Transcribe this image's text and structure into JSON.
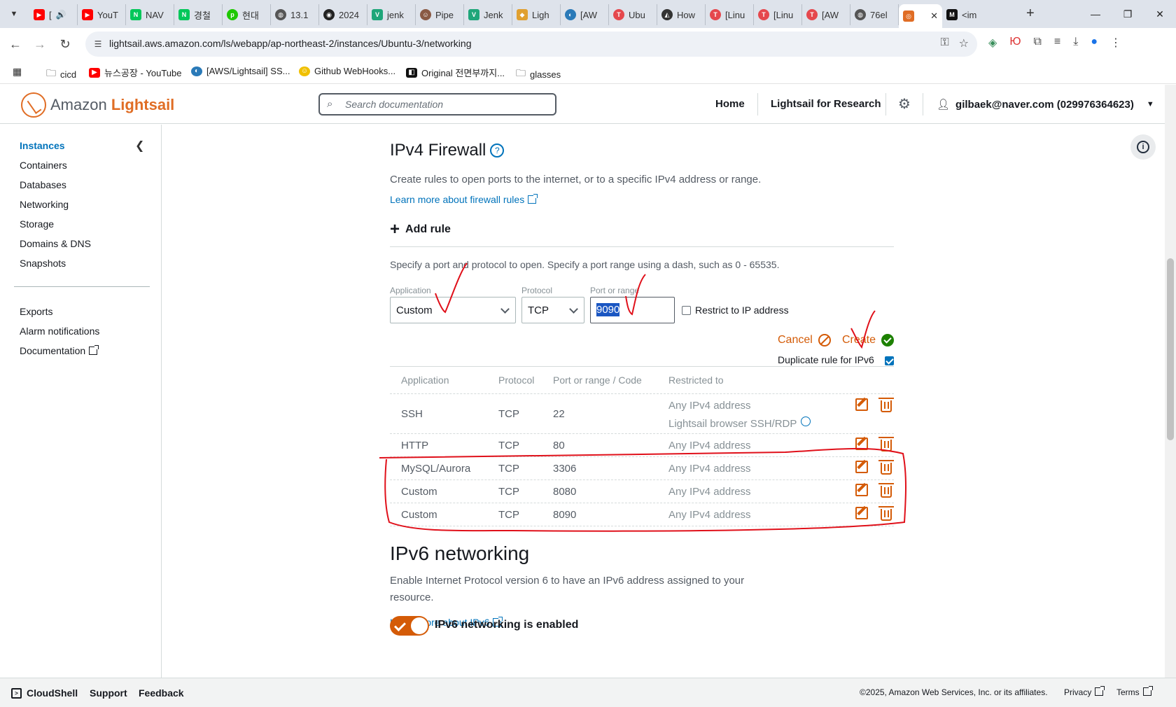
{
  "browser": {
    "tabs": [
      {
        "label": "[",
        "color": "#ff0000",
        "glyph": "▶"
      },
      {
        "label": "YouT",
        "color": "#ff0000",
        "glyph": "▶"
      },
      {
        "label": "NAV",
        "color": "#03c75a",
        "glyph": "N"
      },
      {
        "label": "경철",
        "color": "#03c75a",
        "glyph": "N"
      },
      {
        "label": "현대",
        "color": "#1ec800",
        "glyph": "p"
      },
      {
        "label": "13.1",
        "color": "#555555",
        "glyph": "◍"
      },
      {
        "label": "2024",
        "color": "#222222",
        "glyph": "◉"
      },
      {
        "label": "jenk",
        "color": "#1fa67a",
        "glyph": "V"
      },
      {
        "label": "Pipe",
        "color": "#8a5a44",
        "glyph": "☺"
      },
      {
        "label": "Jenk",
        "color": "#1fa67a",
        "glyph": "V"
      },
      {
        "label": "Ligh",
        "color": "#e0a030",
        "glyph": "◆"
      },
      {
        "label": "[AW",
        "color": "#2a7ab8",
        "glyph": "◐"
      },
      {
        "label": "Ubu",
        "color": "#e5484d",
        "glyph": "T"
      },
      {
        "label": "How",
        "color": "#333333",
        "glyph": "◭"
      },
      {
        "label": "[Linu",
        "color": "#e5484d",
        "glyph": "T"
      },
      {
        "label": "[Linu",
        "color": "#e5484d",
        "glyph": "T"
      },
      {
        "label": "[AW",
        "color": "#e5484d",
        "glyph": "T"
      },
      {
        "label": "76el",
        "color": "#555555",
        "glyph": "◍"
      }
    ],
    "active_tab": {
      "color": "#e06d25",
      "glyph": "◎"
    },
    "last_tab": {
      "label": "<im",
      "color": "#111111",
      "glyph": "M"
    },
    "url": "lightsail.aws.amazon.com/ls/webapp/ap-northeast-2/instances/Ubuntu-3/networking",
    "bookmarks": [
      {
        "label": "cicd",
        "icon": "folder-icon"
      },
      {
        "label": "뉴스공장 - YouTube",
        "icon": "youtube-icon"
      },
      {
        "label": "[AWS/Lightsail] SS...",
        "icon": "web-icon"
      },
      {
        "label": "Github WebHooks...",
        "icon": "web-icon"
      },
      {
        "label": "Original 전면부까지...",
        "icon": "web-icon"
      },
      {
        "label": "glasses",
        "icon": "folder-icon"
      }
    ]
  },
  "header": {
    "logo_prefix": "Amazon",
    "logo_brand": "Lightsail",
    "search_placeholder": "Search documentation",
    "home": "Home",
    "research": "Lightsail for Research",
    "account": "gilbaek@naver.com (029976364623)"
  },
  "sidebar": {
    "items": [
      "Instances",
      "Containers",
      "Databases",
      "Networking",
      "Storage",
      "Domains & DNS",
      "Snapshots"
    ],
    "items2": [
      "Exports",
      "Alarm notifications",
      "Documentation"
    ]
  },
  "firewall": {
    "title": "IPv4 Firewall",
    "description": "Create rules to open ports to the internet, or to a specific IPv4 address or range.",
    "learn_more": "Learn more about firewall rules",
    "add_rule": "Add rule",
    "add_rule_hint": "Specify a port and protocol to open. Specify a port range using a dash, such as 0 - 65535.",
    "form": {
      "application_label": "Application",
      "application_value": "Custom",
      "protocol_label": "Protocol",
      "protocol_value": "TCP",
      "port_label": "Port or range",
      "port_value": "9090",
      "restrict_label": "Restrict to IP address",
      "cancel": "Cancel",
      "create": "Create",
      "duplicate_label": "Duplicate rule for IPv6",
      "duplicate_checked": true
    },
    "columns": [
      "Application",
      "Protocol",
      "Port or range / Code",
      "Restricted to"
    ],
    "rows": [
      {
        "application": "SSH",
        "protocol": "TCP",
        "port": "22",
        "restricted": "Any IPv4 address",
        "extra": "Lightsail browser SSH/RDP"
      },
      {
        "application": "HTTP",
        "protocol": "TCP",
        "port": "80",
        "restricted": "Any IPv4 address"
      },
      {
        "application": "MySQL/Aurora",
        "protocol": "TCP",
        "port": "3306",
        "restricted": "Any IPv4 address"
      },
      {
        "application": "Custom",
        "protocol": "TCP",
        "port": "8080",
        "restricted": "Any IPv4 address"
      },
      {
        "application": "Custom",
        "protocol": "TCP",
        "port": "8090",
        "restricted": "Any IPv4 address"
      }
    ]
  },
  "ipv6": {
    "title": "IPv6 networking",
    "description_1": "Enable Internet Protocol version 6 to have an IPv6 address assigned to your",
    "description_2": "resource.",
    "learn_more": "Learn more about IPv6",
    "toggle_label": "IPv6 networking is enabled",
    "enabled": true
  },
  "footer": {
    "cloudshell": "CloudShell",
    "support": "Support",
    "feedback": "Feedback",
    "copyright": "©2025, Amazon Web Services, Inc. or its affiliates.",
    "privacy": "Privacy",
    "terms": "Terms"
  },
  "colors": {
    "accent": "#0073bb",
    "action": "#d45b07",
    "annotation": "#e0101a"
  }
}
